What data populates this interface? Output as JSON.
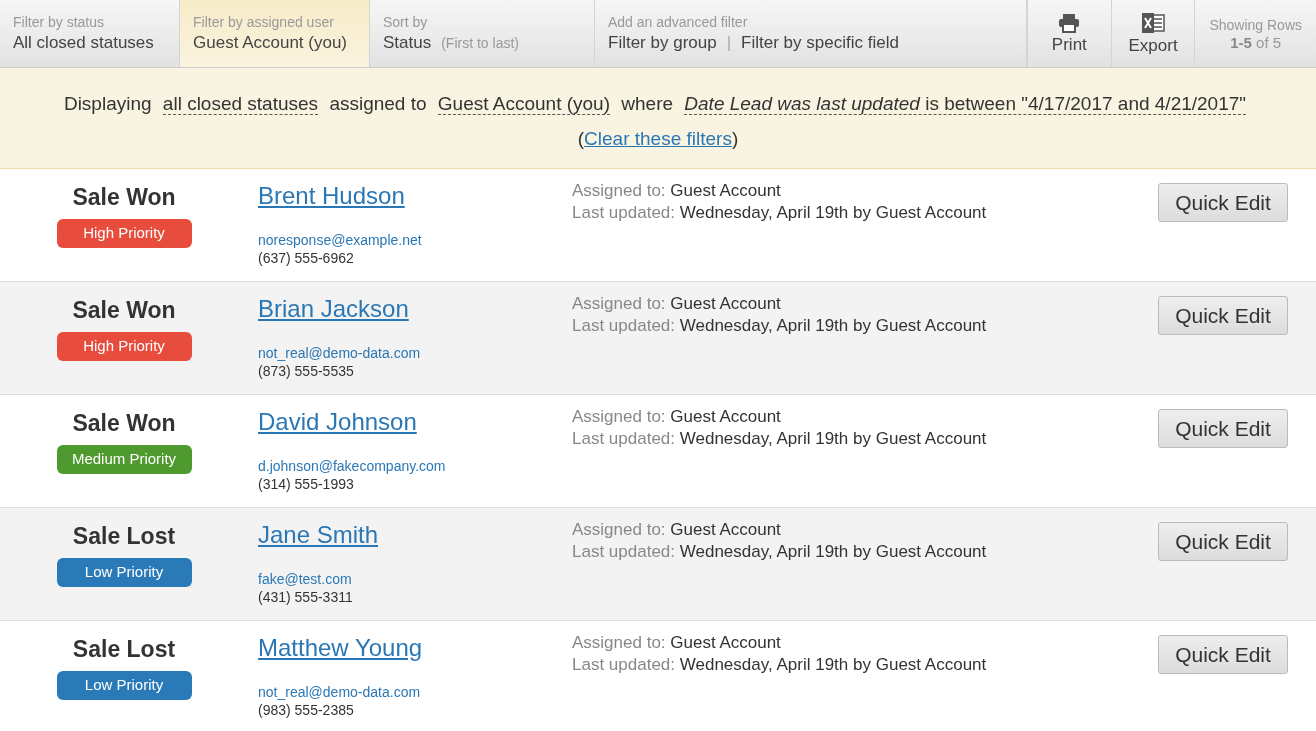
{
  "toolbar": {
    "sections": [
      {
        "kind": "filter",
        "label": "Filter by status",
        "value": "All closed statuses",
        "selected": false
      },
      {
        "kind": "filter",
        "label": "Filter by assigned user",
        "value": "Guest Account (you)",
        "selected": true
      },
      {
        "kind": "sort",
        "label": "Sort by",
        "value": "Status",
        "note": "(First to last)",
        "selected": false
      },
      {
        "kind": "advanced",
        "label": "Add an advanced filter",
        "links": [
          "Filter by group",
          "Filter by specific field"
        ],
        "separator": "|",
        "selected": false
      }
    ],
    "actions": [
      {
        "kind": "print",
        "label": "Print"
      },
      {
        "kind": "export",
        "label": "Export"
      }
    ],
    "rows_info": {
      "label": "Showing Rows",
      "range": "1-5",
      "total": "of 5"
    }
  },
  "banner": {
    "parts": [
      {
        "kind": "text",
        "text": "Displaying"
      },
      {
        "kind": "filter",
        "text": "all closed statuses"
      },
      {
        "kind": "text",
        "text": "assigned to"
      },
      {
        "kind": "filter",
        "text": "Guest Account (you)"
      },
      {
        "kind": "text",
        "text": "where"
      },
      {
        "kind": "filter",
        "text": "*Date Lead was last updated* is between \"4/17/2017 and 4/21/2017\""
      },
      {
        "kind": "text",
        "text": "("
      },
      {
        "kind": "link",
        "text": "Clear these filters"
      },
      {
        "kind": "text",
        "text": ")"
      }
    ]
  },
  "leads": [
    {
      "status": "Sale Won",
      "priority": {
        "label": "High Priority",
        "color": "#e74c3c"
      },
      "name": "Brent Hudson",
      "email": "noresponse@example.net",
      "phone": "(637) 555-6962",
      "assigned_label": "Assigned to:",
      "assigned": "Guest Account",
      "updated_label": "Last updated:",
      "updated": "Wednesday, April 19th by Guest Account",
      "button": "Quick Edit"
    },
    {
      "status": "Sale Won",
      "priority": {
        "label": "High Priority",
        "color": "#e74c3c"
      },
      "name": "Brian Jackson",
      "email": "not_real@demo-data.com",
      "phone": "(873) 555-5535",
      "assigned_label": "Assigned to:",
      "assigned": "Guest Account",
      "updated_label": "Last updated:",
      "updated": "Wednesday, April 19th by Guest Account",
      "button": "Quick Edit"
    },
    {
      "status": "Sale Won",
      "priority": {
        "label": "Medium Priority",
        "color": "#4e9a2f"
      },
      "name": "David Johnson",
      "email": "d.johnson@fakecompany.com",
      "phone": "(314) 555-1993",
      "assigned_label": "Assigned to:",
      "assigned": "Guest Account",
      "updated_label": "Last updated:",
      "updated": "Wednesday, April 19th by Guest Account",
      "button": "Quick Edit"
    },
    {
      "status": "Sale Lost",
      "priority": {
        "label": "Low Priority",
        "color": "#2a7ab8"
      },
      "name": "Jane Smith",
      "email": "fake@test.com",
      "phone": "(431) 555-3311",
      "assigned_label": "Assigned to:",
      "assigned": "Guest Account",
      "updated_label": "Last updated:",
      "updated": "Wednesday, April 19th by Guest Account",
      "button": "Quick Edit"
    },
    {
      "status": "Sale Lost",
      "priority": {
        "label": "Low Priority",
        "color": "#2a7ab8"
      },
      "name": "Matthew Young",
      "email": "not_real@demo-data.com",
      "phone": "(983) 555-2385",
      "assigned_label": "Assigned to:",
      "assigned": "Guest Account",
      "updated_label": "Last updated:",
      "updated": "Wednesday, April 19th by Guest Account",
      "button": "Quick Edit"
    }
  ]
}
